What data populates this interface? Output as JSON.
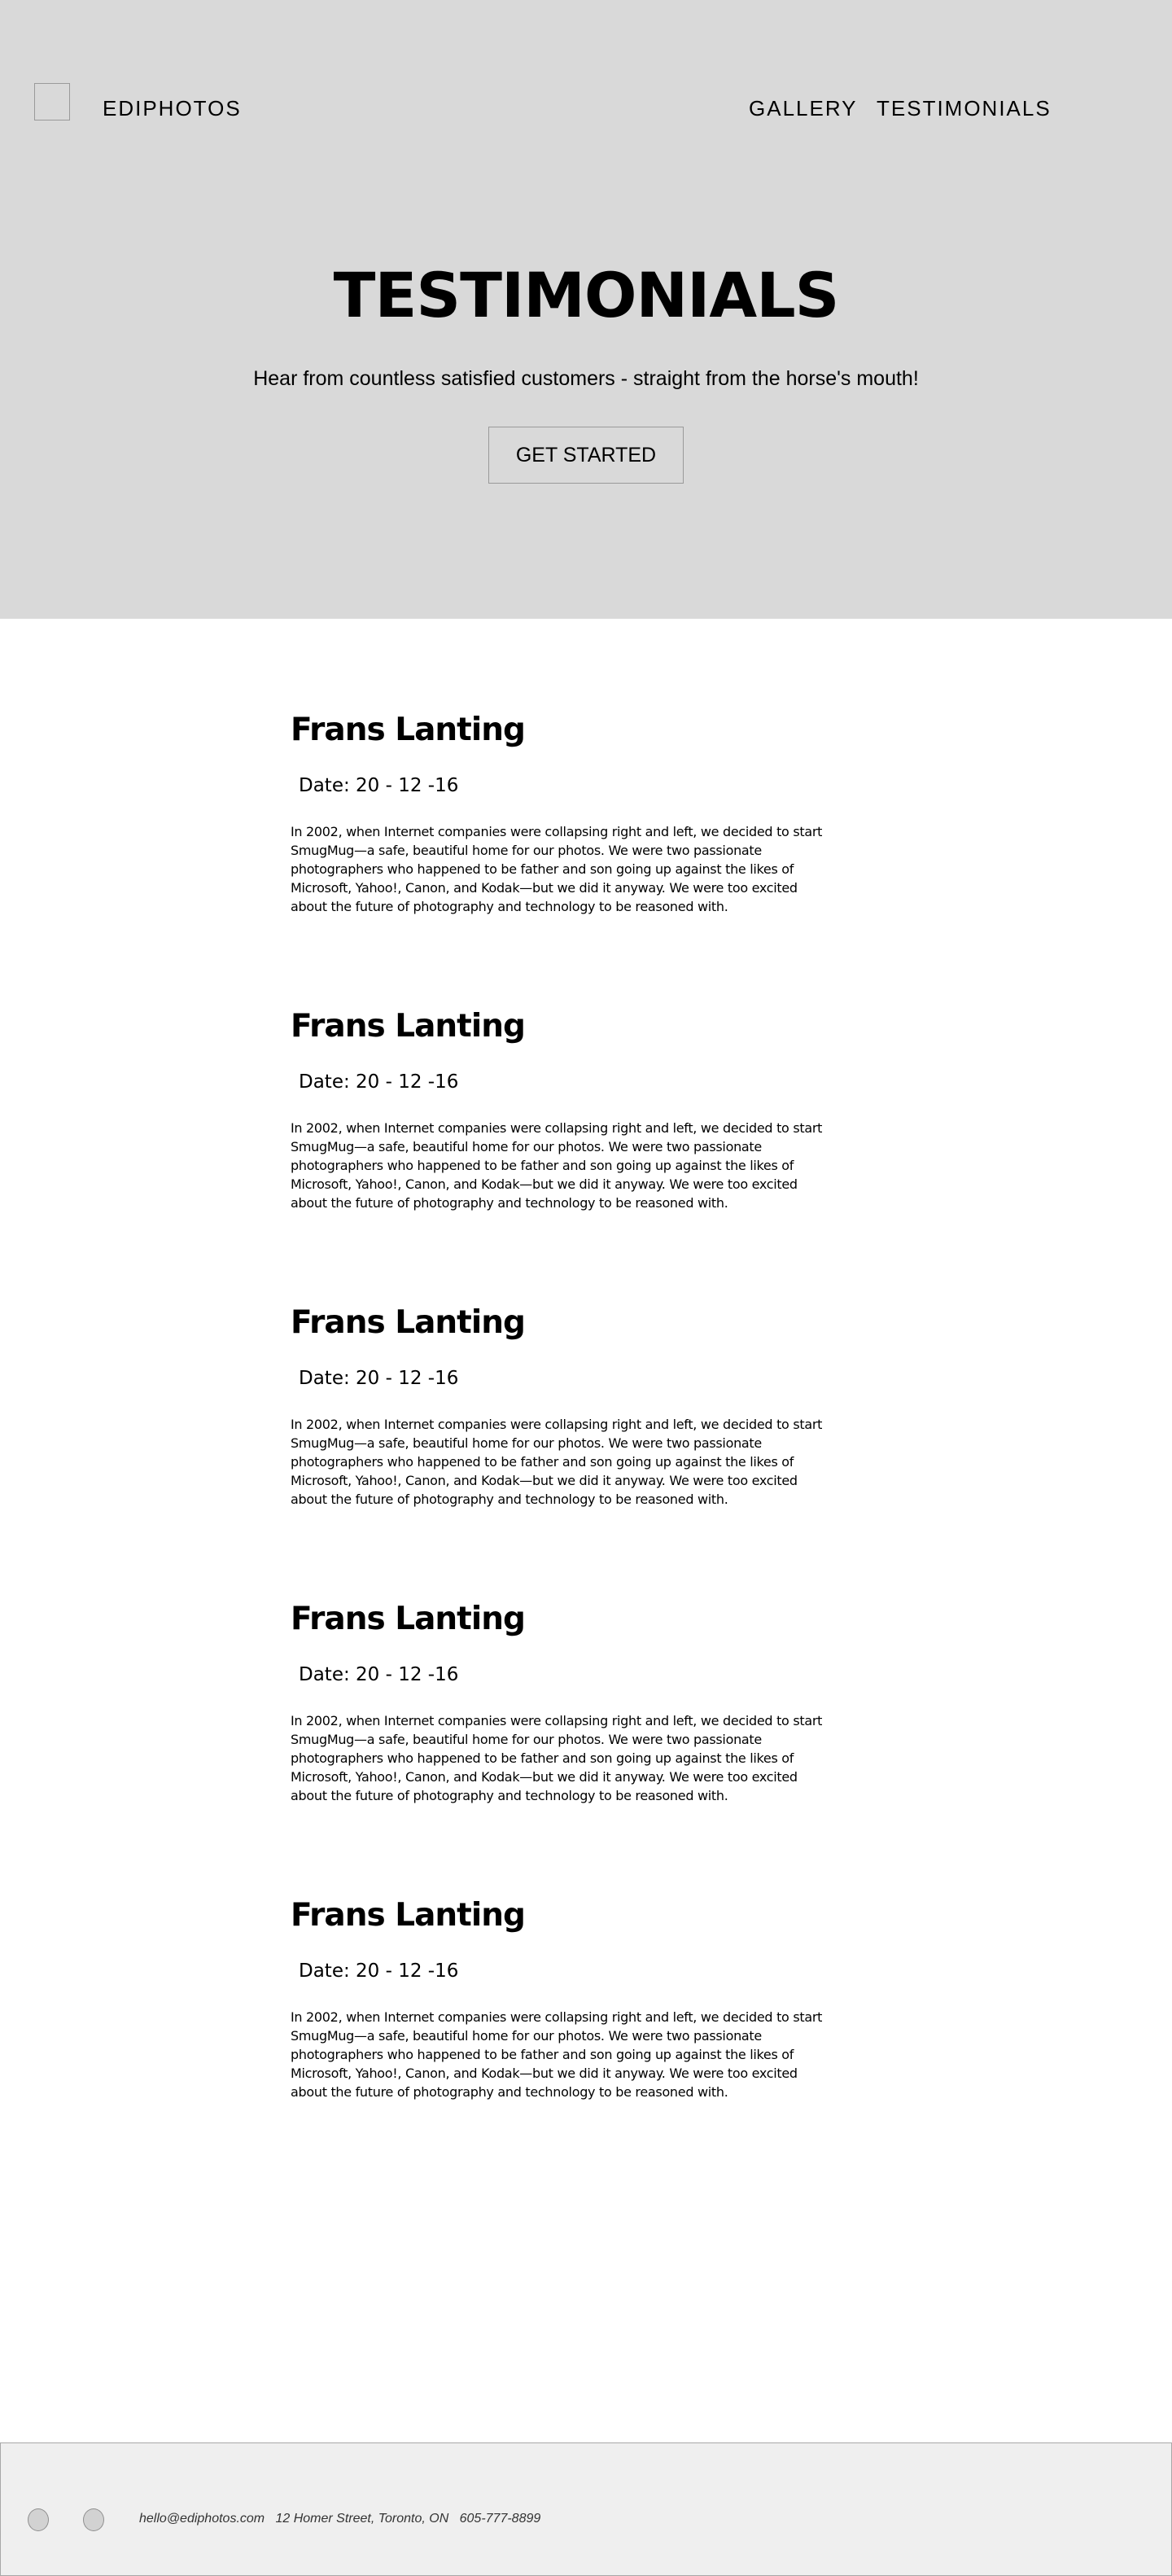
{
  "header": {
    "brand": "EDIPHOTOS",
    "nav": [
      "GALLERY",
      "TESTIMONIALS"
    ]
  },
  "hero": {
    "title": "TESTIMONIALS",
    "subtitle": "Hear from countless satisfied customers - straight from the horse's mouth!",
    "cta_label": "GET STARTED"
  },
  "testimonials": [
    {
      "name": "Frans Lanting",
      "date": "Date: 20 - 12 -16",
      "body": "In 2002, when Internet companies were collapsing right and left, we decided to start SmugMug—a safe, beautiful home for our photos. We were two passionate photographers who happened to be father and son going up against the likes of Microsoft, Yahoo!, Canon, and Kodak—but we did it anyway. We were too excited about the future of photography and technology to be reasoned with."
    },
    {
      "name": "Frans Lanting",
      "date": "Date: 20 - 12 -16",
      "body": "In 2002, when Internet companies were collapsing right and left, we decided to start SmugMug—a safe, beautiful home for our photos. We were two passionate photographers who happened to be father and son going up against the likes of Microsoft, Yahoo!, Canon, and Kodak—but we did it anyway. We were too excited about the future of photography and technology to be reasoned with."
    },
    {
      "name": "Frans Lanting",
      "date": "Date: 20 - 12 -16",
      "body": "In 2002, when Internet companies were collapsing right and left, we decided to start SmugMug—a safe, beautiful home for our photos. We were two passionate photographers who happened to be father and son going up against the likes of Microsoft, Yahoo!, Canon, and Kodak—but we did it anyway. We were too excited about the future of photography and technology to be reasoned with."
    },
    {
      "name": "Frans Lanting",
      "date": "Date: 20 - 12 -16",
      "body": "In 2002, when Internet companies were collapsing right and left, we decided to start SmugMug—a safe, beautiful home for our photos. We were two passionate photographers who happened to be father and son going up against the likes of Microsoft, Yahoo!, Canon, and Kodak—but we did it anyway. We were too excited about the future of photography and technology to be reasoned with."
    },
    {
      "name": "Frans Lanting",
      "date": "Date: 20 - 12 -16",
      "body": "In 2002, when Internet companies were collapsing right and left, we decided to start SmugMug—a safe, beautiful home for our photos. We were two passionate photographers who happened to be father and son going up against the likes of Microsoft, Yahoo!, Canon, and Kodak—but we did it anyway. We were too excited about the future of photography and technology to be reasoned with."
    }
  ],
  "footer": {
    "contact": "hello@ediphotos.com   12 Homer Street, Toronto, ON   605-777-8899",
    "social_icons": [
      "social-icon",
      "social-icon"
    ]
  },
  "colors": {
    "hero_bg": "#d9d9d9",
    "footer_bg": "#efefef",
    "border": "#9a9a9a",
    "text": "#000000"
  }
}
